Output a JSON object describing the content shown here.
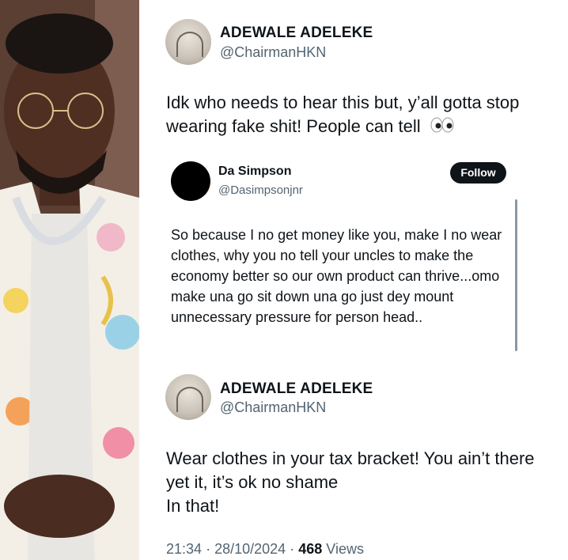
{
  "first_tweet": {
    "name": "ADEWALE ADELEKE",
    "handle": "@ChairmanHKN",
    "text": "Idk who needs to hear this but, y’all gotta stop wearing fake shit! People can tell",
    "emoji": "eyes-emoji"
  },
  "quoted_reply": {
    "name": "Da Simpson",
    "handle": "@Dasimpsonjnr",
    "follow_label": "Follow",
    "text": "So because I no get money like you, make I no wear clothes, why you no tell your uncles to make the economy better so our own product can thrive...omo make una go sit down una go just dey mount unnecessary pressure for person head.."
  },
  "second_tweet": {
    "name": "ADEWALE ADELEKE",
    "handle": "@ChairmanHKN",
    "text_line1": "Wear clothes in your tax bracket! You ain’t there yet it, it’s ok no shame",
    "text_line2": "In that!",
    "time": "21:34",
    "sep1": "·",
    "date": "28/10/2024",
    "sep2": "·",
    "views_count": "468",
    "views_label": "Views"
  },
  "colors": {
    "text": "#0f1419",
    "secondary": "#536471",
    "follow_bg": "#0f1419"
  }
}
